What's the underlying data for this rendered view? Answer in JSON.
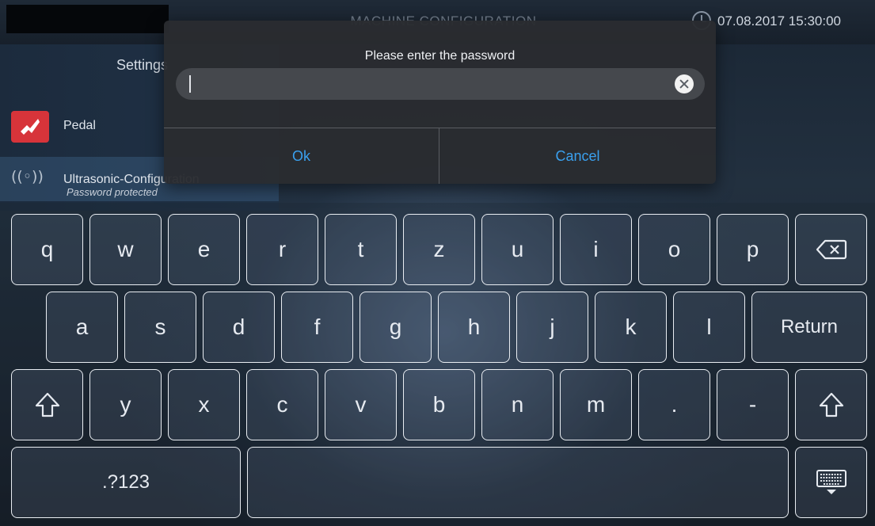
{
  "header": {
    "title": "MACHINE CONFIGURATION",
    "datetime": "07.08.2017 15:30:00"
  },
  "sidebar": {
    "title": "Settings",
    "items": [
      {
        "label": "Pedal",
        "icon": "pedal-icon"
      },
      {
        "label": "Ultrasonic-Configuration",
        "sublabel": "Password protected",
        "icon": "ultrasonic-icon"
      }
    ]
  },
  "dialog": {
    "prompt": "Please enter the password",
    "password_value": "",
    "ok_label": "Ok",
    "cancel_label": "Cancel",
    "accent_color": "#3aa0ee"
  },
  "keyboard": {
    "row1": [
      "q",
      "w",
      "e",
      "r",
      "t",
      "z",
      "u",
      "i",
      "o",
      "p"
    ],
    "row2": [
      "a",
      "s",
      "d",
      "f",
      "g",
      "h",
      "j",
      "k",
      "l"
    ],
    "row3": [
      "y",
      "x",
      "c",
      "v",
      "b",
      "n",
      "m",
      ".",
      "-"
    ],
    "return_label": "Return",
    "symbols_label": ".?123",
    "backspace_icon": "backspace-icon",
    "shift_icon": "shift-icon",
    "hide_keyboard_icon": "hide-keyboard-icon"
  }
}
